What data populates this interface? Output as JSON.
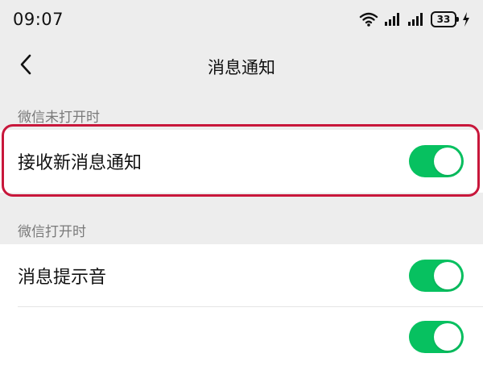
{
  "status_bar": {
    "time": "09:07",
    "battery": "33"
  },
  "header": {
    "title": "消息通知"
  },
  "sections": [
    {
      "header": "微信未打开时",
      "rows": [
        {
          "label": "接收新消息通知",
          "enabled": true
        }
      ]
    },
    {
      "header": "微信打开时",
      "rows": [
        {
          "label": "消息提示音",
          "enabled": true
        },
        {
          "label": "",
          "enabled": true
        }
      ]
    }
  ],
  "icons": {
    "back": "chevron-left-icon",
    "wifi": "wifi-icon",
    "signal": "signal-icon",
    "battery": "battery-icon",
    "charging": "charging-bolt-icon"
  },
  "colors": {
    "accent": "#07c160",
    "highlight": "#c8173b",
    "background": "#ededed"
  }
}
